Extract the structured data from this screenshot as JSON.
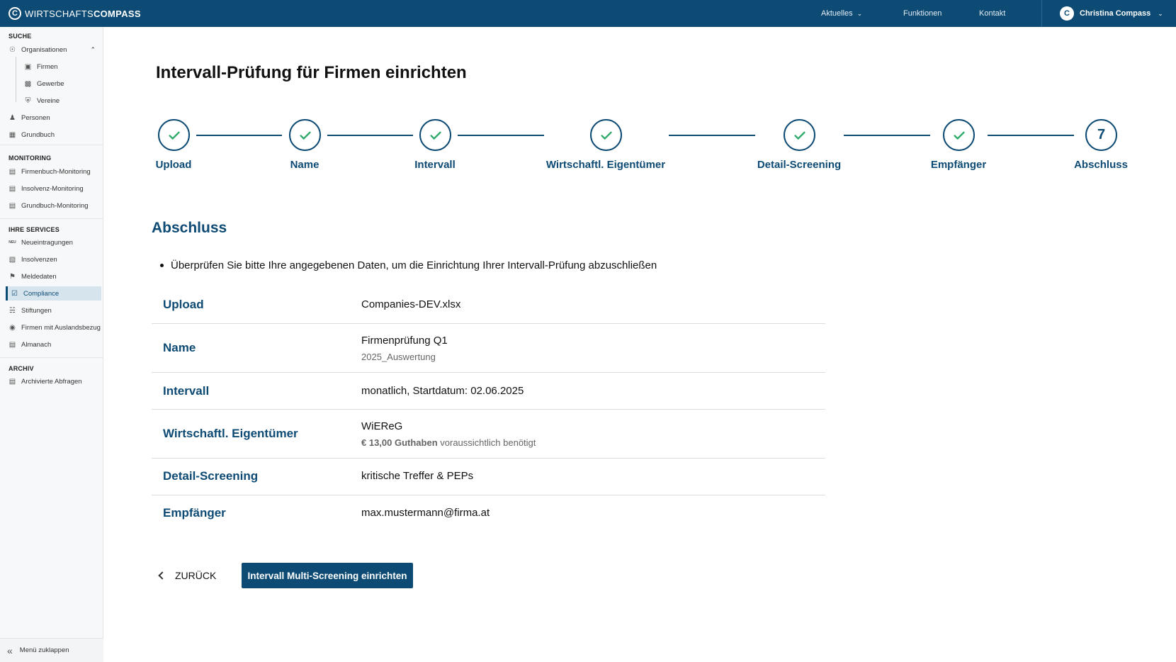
{
  "brand": {
    "light": "WIRTSCHAFTS",
    "bold": "COMPASS",
    "mark": "C"
  },
  "topnav": {
    "aktuelles": "Aktuelles",
    "funktionen": "Funktionen",
    "kontakt": "Kontakt"
  },
  "user": {
    "name": "Christina Compass",
    "avatar": "C"
  },
  "sidebar": {
    "sections": {
      "suche": "SUCHE",
      "monitoring": "MONITORING",
      "services": "IHRE SERVICES",
      "archiv": "ARCHIV"
    },
    "suche": {
      "organisationen": "Organisationen",
      "firmen": "Firmen",
      "gewerbe": "Gewerbe",
      "vereine": "Vereine",
      "personen": "Personen",
      "grundbuch": "Grundbuch"
    },
    "monitoring": {
      "firmenbuch": "Firmenbuch-Monitoring",
      "insolvenz": "Insolvenz-Monitoring",
      "grundbuch": "Grundbuch-Monitoring"
    },
    "services": {
      "neueintragungen": "Neueintragungen",
      "neu_badge": "NEU",
      "insolvenzen": "Insolvenzen",
      "meldedaten": "Meldedaten",
      "compliance": "Compliance",
      "stiftungen": "Stiftungen",
      "ausland": "Firmen mit Auslandsbezug",
      "almanach": "Almanach"
    },
    "archiv": {
      "abfragen": "Archivierte Abfragen"
    },
    "collapse": "Menü zuklappen"
  },
  "page": {
    "title": "Intervall-Prüfung für Firmen einrichten"
  },
  "stepper": {
    "steps": [
      {
        "label": "Upload",
        "done": true
      },
      {
        "label": "Name",
        "done": true
      },
      {
        "label": "Intervall",
        "done": true
      },
      {
        "label": "Wirtschaftl. Eigentümer",
        "done": true
      },
      {
        "label": "Detail-Screening",
        "done": true
      },
      {
        "label": "Empfänger",
        "done": true
      },
      {
        "label": "Abschluss",
        "done": false,
        "number": "7"
      }
    ]
  },
  "summary": {
    "title": "Abschluss",
    "intro": "Überprüfen Sie bitte Ihre angegebenen Daten, um die Einrichtung Ihrer Intervall-Prüfung abzuschließen",
    "rows": {
      "upload": {
        "key": "Upload",
        "value": "Companies-DEV.xlsx"
      },
      "name": {
        "key": "Name",
        "value": "Firmenprüfung Q1",
        "sub": "2025_Auswertung"
      },
      "intervall": {
        "key": "Intervall",
        "value": "monatlich, Startdatum: 02.06.2025"
      },
      "eigentuemer": {
        "key": "Wirtschaftl. Eigentümer",
        "value": "WiEReG",
        "sub_bold": "€ 13,00 Guthaben",
        "sub_rest": " voraussichtlich benötigt"
      },
      "screening": {
        "key": "Detail-Screening",
        "value": "kritische Treffer & PEPs"
      },
      "empfaenger": {
        "key": "Empfänger",
        "value": "max.mustermann@firma.at"
      }
    }
  },
  "actions": {
    "back": "ZURÜCK",
    "submit": "Intervall Multi-Screening einrichten"
  },
  "colors": {
    "primary": "#0d4a74",
    "check": "#2eaa6a",
    "active_bg": "#d6e4ee"
  }
}
